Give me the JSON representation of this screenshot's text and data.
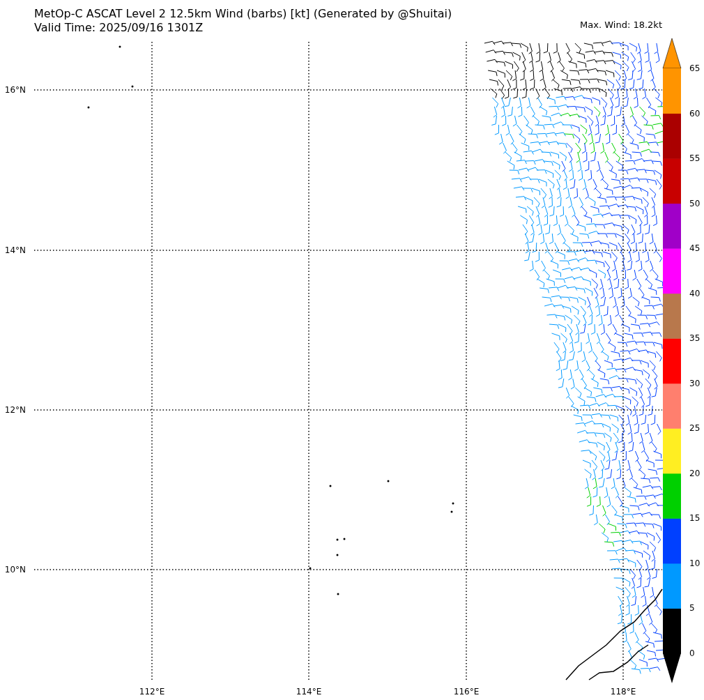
{
  "title": "MetOp-C ASCAT Level 2 12.5km Wind (barbs) [kt] (Generated by @Shuitai)",
  "subtitle": "Valid Time: 2025/09/16 1301Z",
  "max_wind": "Max. Wind: 18.2kt",
  "map": {
    "lat_labels": [
      "16°N",
      "14°N",
      "12°N",
      "10°N"
    ],
    "lon_labels": [
      "112°E",
      "114°E",
      "116°E",
      "118°E"
    ]
  },
  "colorbar": {
    "ticks": [
      "65",
      "60",
      "55",
      "50",
      "45",
      "40",
      "35",
      "30",
      "25",
      "20",
      "15",
      "10",
      "5",
      "0"
    ],
    "segments": [
      {
        "color": "#000000"
      },
      {
        "color": "#0099ff"
      },
      {
        "color": "#0040ff"
      },
      {
        "color": "#00d000"
      },
      {
        "color": "#ffee22"
      },
      {
        "color": "#ff7f6e"
      },
      {
        "color": "#ff0000"
      },
      {
        "color": "#b8784c"
      },
      {
        "color": "#ff00ff"
      },
      {
        "color": "#a000c8"
      },
      {
        "color": "#c80000"
      },
      {
        "color": "#aa0000"
      },
      {
        "color": "#ff9400"
      }
    ]
  }
}
